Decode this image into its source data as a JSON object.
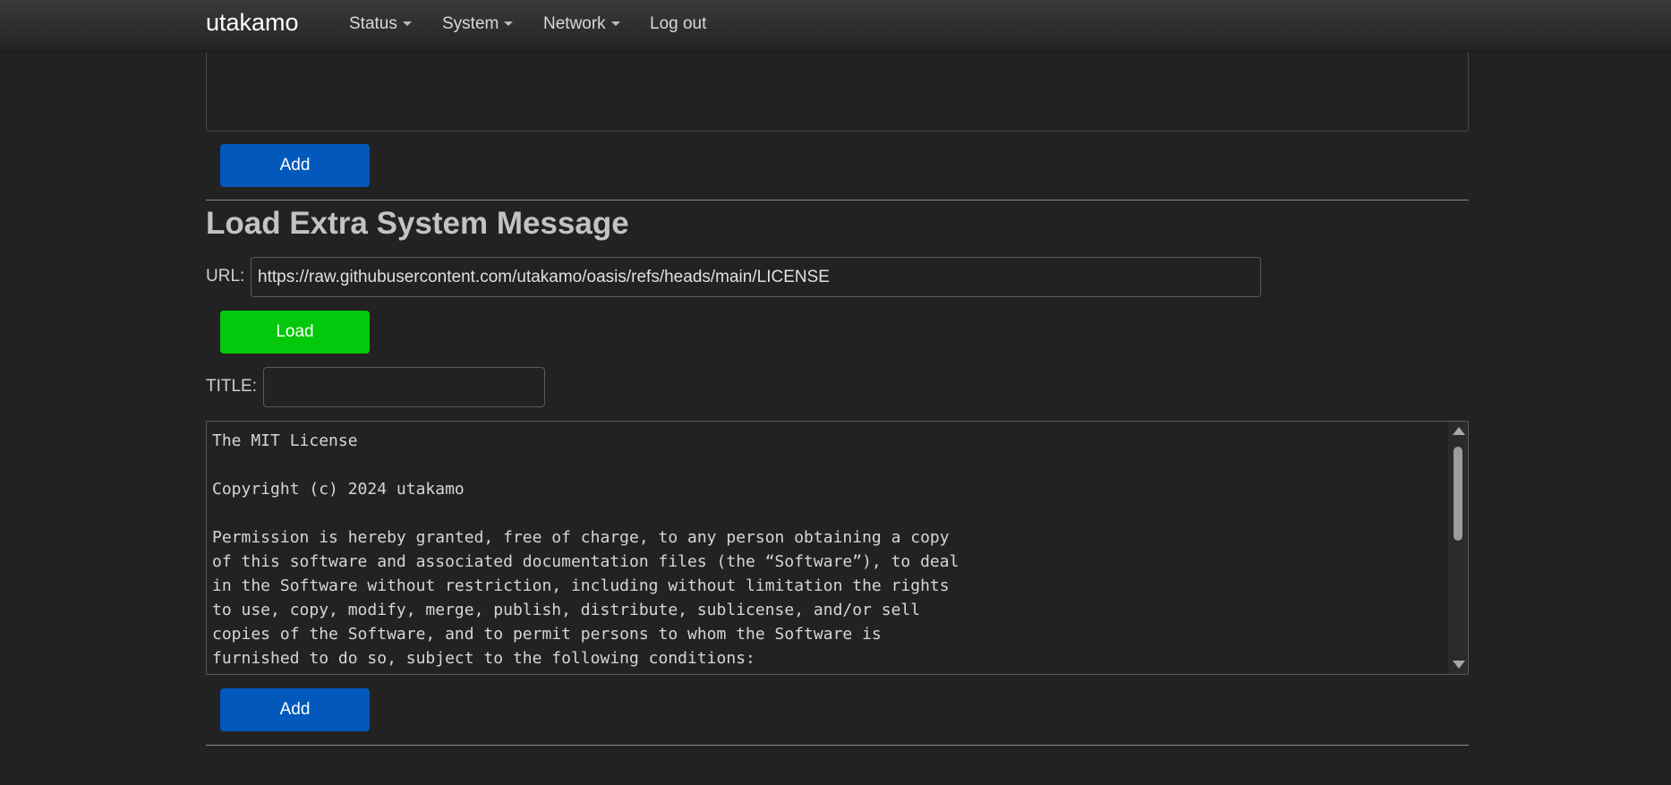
{
  "navbar": {
    "brand": "utakamo",
    "menus": [
      {
        "label": "Status"
      },
      {
        "label": "System"
      },
      {
        "label": "Network"
      }
    ],
    "logout": "Log out"
  },
  "previous_section": {
    "add_button": "Add"
  },
  "load_section": {
    "title": "Load Extra System Message",
    "url_label": "URL:",
    "url_value": "https://raw.githubusercontent.com/utakamo/oasis/refs/heads/main/LICENSE",
    "load_button": "Load",
    "title_label": "TITLE:",
    "title_value": "",
    "content": "The MIT License\n\nCopyright (c) 2024 utakamo\n\nPermission is hereby granted, free of charge, to any person obtaining a copy\nof this software and associated documentation files (the “Software”), to deal\nin the Software without restriction, including without limitation the rights\nto use, copy, modify, merge, publish, distribute, sublicense, and/or sell\ncopies of the Software, and to permit persons to whom the Software is\nfurnished to do so, subject to the following conditions:",
    "add_button": "Add"
  },
  "colors": {
    "background": "#222222",
    "primary_button": "#0259bb",
    "success_button": "#04c80b"
  }
}
